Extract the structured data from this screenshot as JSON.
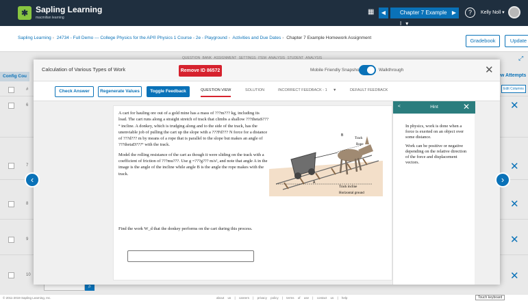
{
  "app": {
    "brand": "Sapling Learning",
    "brand_sub": "macmillan learning",
    "logo_glyph": "✱"
  },
  "topbar": {
    "assignment_select": "Chapter 7 Example I",
    "user": "Kelly Noll ▾",
    "help": "?"
  },
  "breadcrumb": [
    "Sapling Learning",
    "24734 - Full Demo --- College Physics for the AP® Physics 1 Course - 2e - Playground",
    "Activities and Due Dates",
    "Chapter 7 Example Homework Assignment"
  ],
  "header_buttons": {
    "gradebook": "Gradebook",
    "update": "Update"
  },
  "background": {
    "tabs": "QUESTION BANK   ASSIGNMENT   SETTINGS   ITEM ANALYSIS   STUDENT ANALYSIS",
    "columns": "Config  Cou",
    "right_head": "ew Attempts",
    "edit_columns": "Edit Columns",
    "rows": [
      "#",
      "6",
      "7",
      "8",
      "9",
      "10"
    ]
  },
  "modal": {
    "title": "Calculation of Various Types of Work",
    "remove_label": "Remove ID 86572",
    "mobile_label": "Mobile Friendly Snapshot",
    "walkthrough_label": "Walkthrough",
    "toolbar": {
      "check": "Check Answer",
      "regenerate": "Regenerate Values",
      "toggle": "Toggle Feedback",
      "tabs": [
        "QUESTION VIEW",
        "SOLUTION",
        "INCORRECT FEEDBACK - 1",
        "▼",
        "DEFAULT FEEDBACK"
      ]
    }
  },
  "question": {
    "p1": "A cart for hauling ore out of a gold mine has a mass of ???m??? kg, including its load. The cart runs along a straight stretch of track that climbs a shallow ???thetaS???° incline. A donkey, which is trudging along and to the side of the track, has the unenviable job of pulling the cart up the slope with a ???Fd??? N force for a distance of ???d??? m by means of a rope that is parallel to the slope but makes an angle of ???thetaD???° with the track.",
    "p2": "Model the rolling resistance of the cart as though it were sliding on the track with a coefficient of friction of ???mu???. Use g =???g??? m/s², and note that angle A in the image is the angle of the incline while angle B is the angle the rope makes with the track.",
    "p3": "Find the work W_d that the donkey performs on the cart during this process."
  },
  "figure": {
    "label_b": "B",
    "label_track": "Track",
    "label_rope": "Rope",
    "label_a": "A",
    "label_incline": "Track incline",
    "label_ground": "Horizontal ground"
  },
  "hint": {
    "title": "Hint",
    "p1": "In physics, work is done when a force is exerted on an object over some distance.",
    "p2": "Work can be positive or negative depending on the relative direction of the force and displacement vectors."
  },
  "footer": {
    "copyright": "© 2011-2019 Sapling Learning, Inc.",
    "links": "about us | careers | privacy policy | terms of use | contact us | help",
    "keyboard": "Touch keyboard"
  }
}
